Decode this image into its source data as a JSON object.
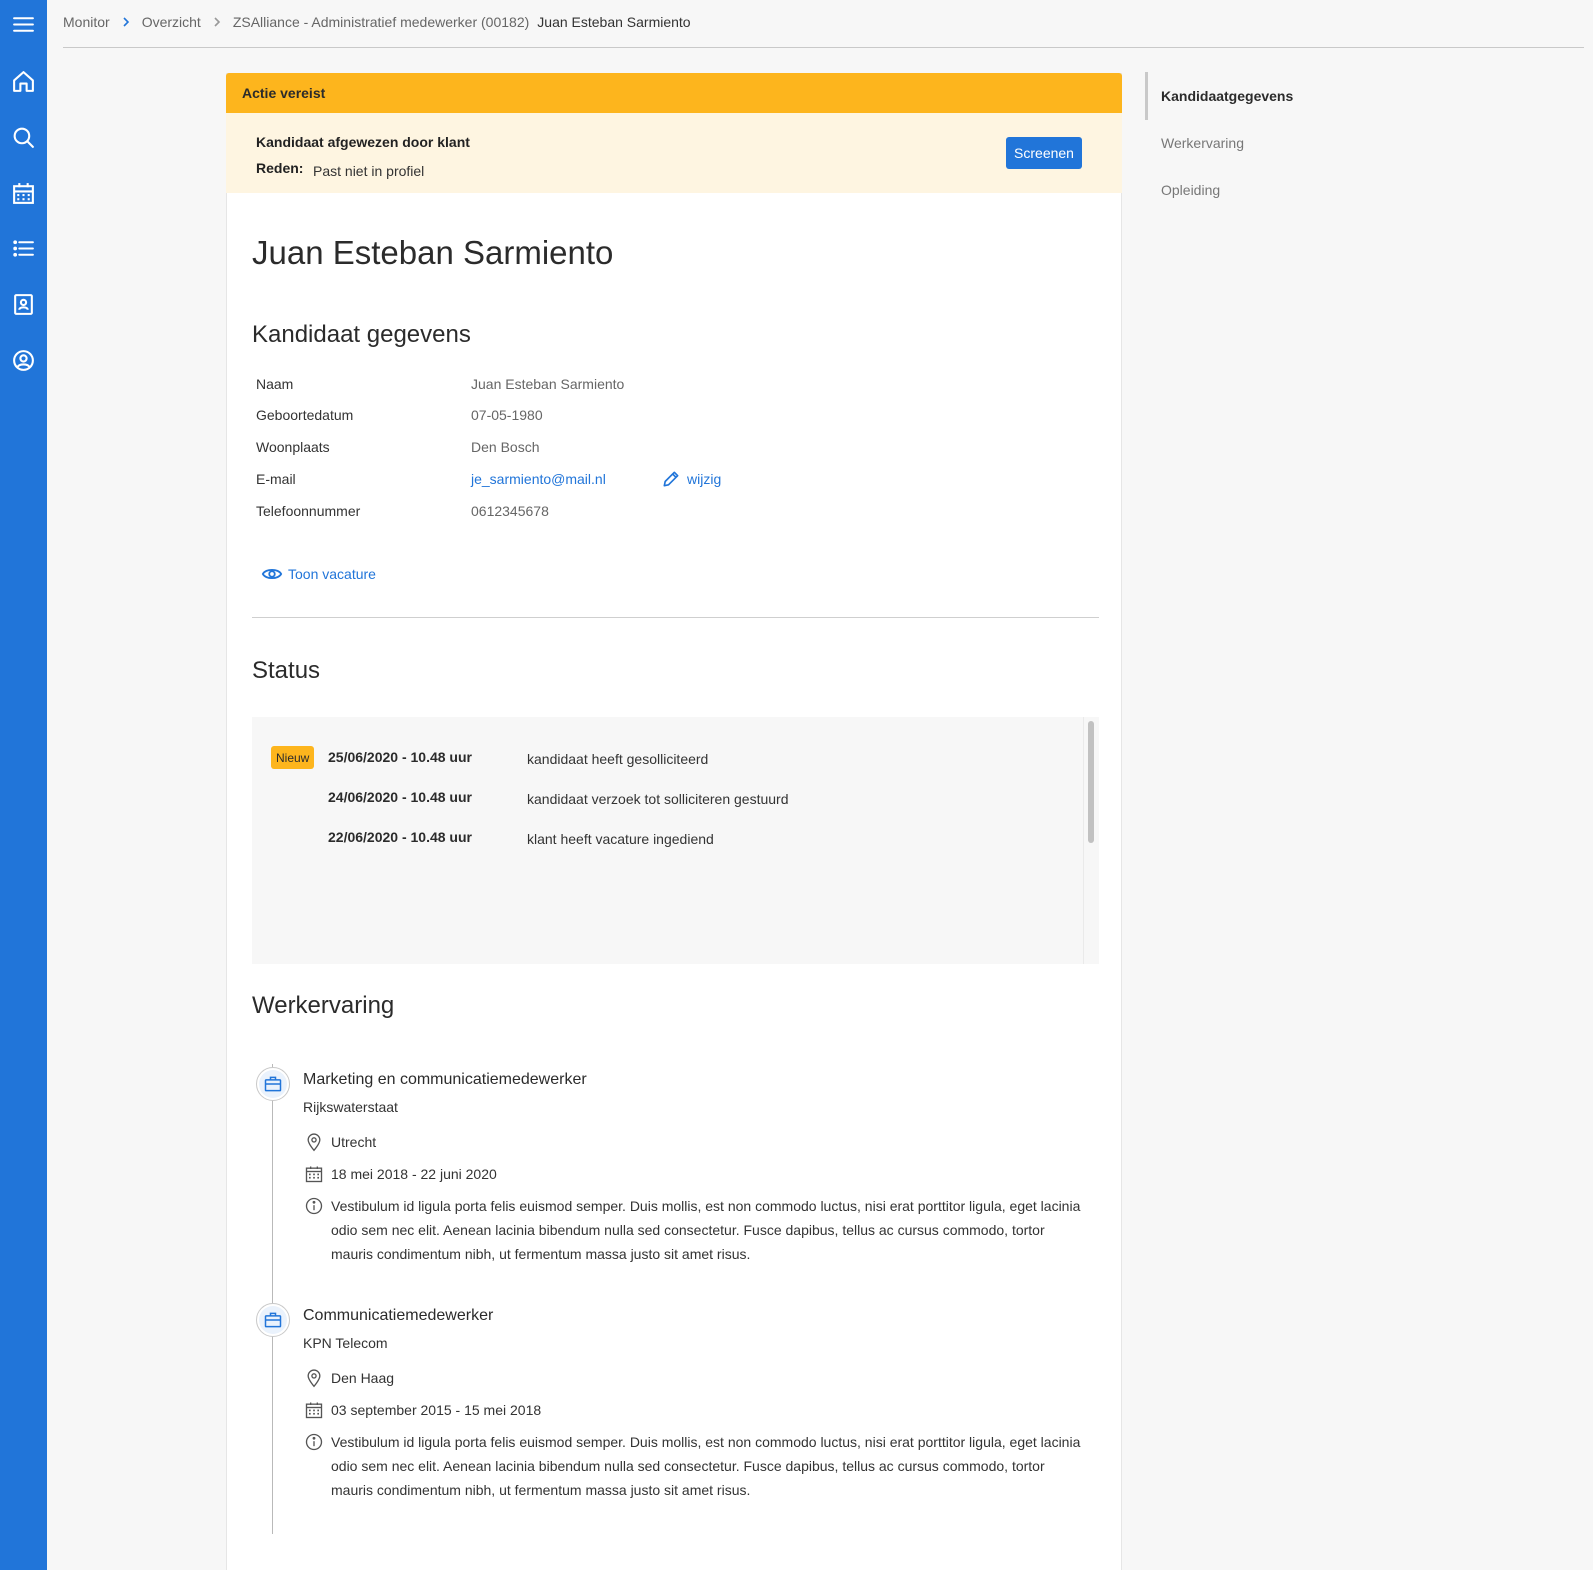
{
  "sidebar": {
    "icons": [
      "menu-icon",
      "home-icon",
      "search-icon",
      "calendar-icon",
      "list-icon",
      "contacts-icon",
      "account-icon"
    ]
  },
  "breadcrumb": {
    "items": [
      "Monitor",
      "Overzicht",
      "ZSAlliance - Administratief medewerker (00182)"
    ],
    "current": "Juan Esteban Sarmiento"
  },
  "alert": {
    "header": "Actie vereist",
    "title": "Kandidaat afgewezen door klant",
    "reason_label": "Reden:",
    "reason": "Past niet in profiel",
    "button": "Screenen"
  },
  "candidate": {
    "name": "Juan Esteban Sarmiento",
    "section_title": "Kandidaat gegevens",
    "fields": [
      {
        "label": "Naam",
        "value": "Juan Esteban Sarmiento"
      },
      {
        "label": "Geboortedatum",
        "value": "07-05-1980"
      },
      {
        "label": "Woonplaats",
        "value": "Den Bosch"
      },
      {
        "label": "E-mail",
        "value": "je_sarmiento@mail.nl"
      },
      {
        "label": "Telefoonnummer",
        "value": "0612345678"
      }
    ],
    "edit_label": "wijzig",
    "show_vacancy": "Toon vacature"
  },
  "status": {
    "title": "Status",
    "badge": "Nieuw",
    "entries": [
      {
        "date": "25/06/2020 - 10.48 uur",
        "text": "kandidaat heeft gesolliciteerd"
      },
      {
        "date": "24/06/2020 - 10.48 uur",
        "text": "kandidaat verzoek tot solliciteren gestuurd"
      },
      {
        "date": "22/06/2020 - 10.48 uur",
        "text": "klant heeft vacature ingediend"
      }
    ]
  },
  "experience": {
    "title": "Werkervaring",
    "jobs": [
      {
        "title": "Marketing en communicatiemedewerker",
        "company": "Rijkswaterstaat",
        "location": "Utrecht",
        "period": "18 mei 2018 - 22 juni 2020",
        "description": "Vestibulum id ligula porta felis euismod semper. Duis mollis, est non commodo luctus, nisi erat porttitor ligula, eget lacinia odio sem nec elit. Aenean lacinia bibendum nulla sed consectetur. Fusce dapibus, tellus ac cursus commodo, tortor mauris condimentum nibh, ut fermentum massa justo sit amet risus."
      },
      {
        "title": "Communicatiemedewerker",
        "company": "KPN Telecom",
        "location": "Den Haag",
        "period": "03 september 2015 - 15 mei 2018",
        "description": "Vestibulum id ligula porta felis euismod semper. Duis mollis, est non commodo luctus, nisi erat porttitor ligula, eget lacinia odio sem nec elit. Aenean lacinia bibendum nulla sed consectetur. Fusce dapibus, tellus ac cursus commodo, tortor mauris condimentum nibh, ut fermentum massa justo sit amet risus."
      }
    ]
  },
  "anchor_nav": {
    "items": [
      "Kandidaatgegevens",
      "Werkervaring",
      "Opleiding"
    ],
    "active": "Kandidaatgegevens"
  },
  "colors": {
    "primary": "#2175d9",
    "alert": "#fdb51d",
    "alert_bg": "#fef5e1"
  }
}
